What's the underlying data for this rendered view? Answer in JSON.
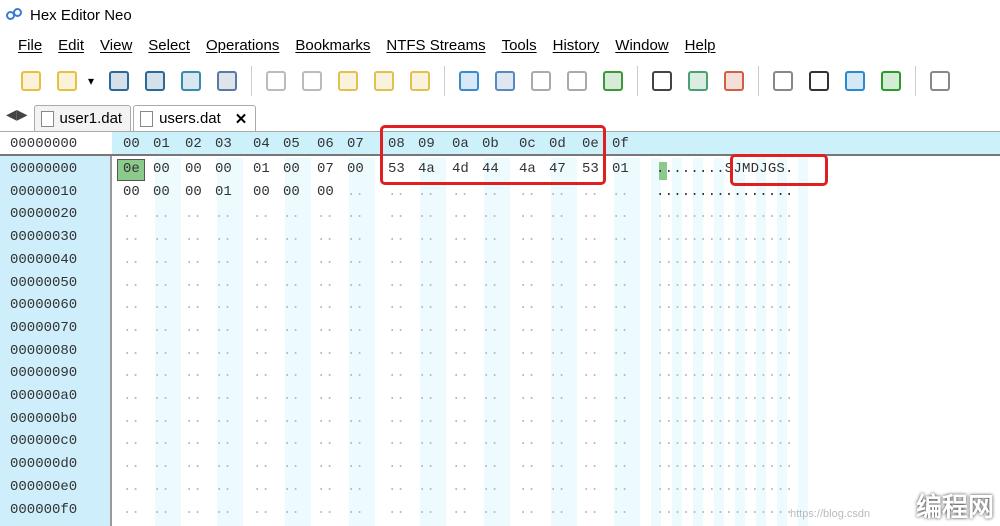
{
  "window": {
    "title": "Hex Editor Neo"
  },
  "menu": [
    "File",
    "Edit",
    "View",
    "Select",
    "Operations",
    "Bookmarks",
    "NTFS Streams",
    "Tools",
    "History",
    "Window",
    "Help"
  ],
  "toolbar": [
    "new-file-icon",
    "open-file-icon",
    "dropdown-icon",
    "save-icon",
    "save-all-icon",
    "save-as-icon",
    "print-icon",
    "undo-icon",
    "redo-icon",
    "edit-icon",
    "copy-icon",
    "paste-icon",
    "export-icon",
    "find-icon",
    "find-next-icon",
    "find-prev-icon",
    "goto-icon",
    "data-inspector-icon",
    "settings-icon",
    "compare-icon",
    "patterns-icon",
    "binary-icon",
    "monitor-icon",
    "pen-icon",
    "help-f1-icon"
  ],
  "tabs": [
    {
      "label": "user1.dat",
      "active": false
    },
    {
      "label": "users.dat",
      "active": true,
      "close": "✕"
    }
  ],
  "hex": {
    "header_addr": "00000000",
    "columns": [
      "00",
      "01",
      "02",
      "03",
      "04",
      "05",
      "06",
      "07",
      "08",
      "09",
      "0a",
      "0b",
      "0c",
      "0d",
      "0e",
      "0f"
    ],
    "rows": [
      {
        "addr": "00000000",
        "bytes": [
          "0e",
          "00",
          "00",
          "00",
          "01",
          "00",
          "07",
          "00",
          "53",
          "4a",
          "4d",
          "44",
          "4a",
          "47",
          "53",
          "01"
        ],
        "ascii": "........SJMDJGS."
      },
      {
        "addr": "00000010",
        "bytes": [
          "00",
          "00",
          "00",
          "01",
          "00",
          "00",
          "00",
          "..",
          "..",
          "..",
          "..",
          "..",
          "..",
          "..",
          "..",
          ".."
        ],
        "ascii": "................"
      },
      {
        "addr": "00000020"
      },
      {
        "addr": "00000030"
      },
      {
        "addr": "00000040"
      },
      {
        "addr": "00000050"
      },
      {
        "addr": "00000060"
      },
      {
        "addr": "00000070"
      },
      {
        "addr": "00000080"
      },
      {
        "addr": "00000090"
      },
      {
        "addr": "000000a0"
      },
      {
        "addr": "000000b0"
      },
      {
        "addr": "000000c0"
      },
      {
        "addr": "000000d0"
      },
      {
        "addr": "000000e0"
      },
      {
        "addr": "000000f0"
      }
    ],
    "selected_byte": "0e",
    "highlight_color": "#e02020"
  },
  "watermark": {
    "text": "编程网",
    "url_text": "https://blog.csdn"
  }
}
